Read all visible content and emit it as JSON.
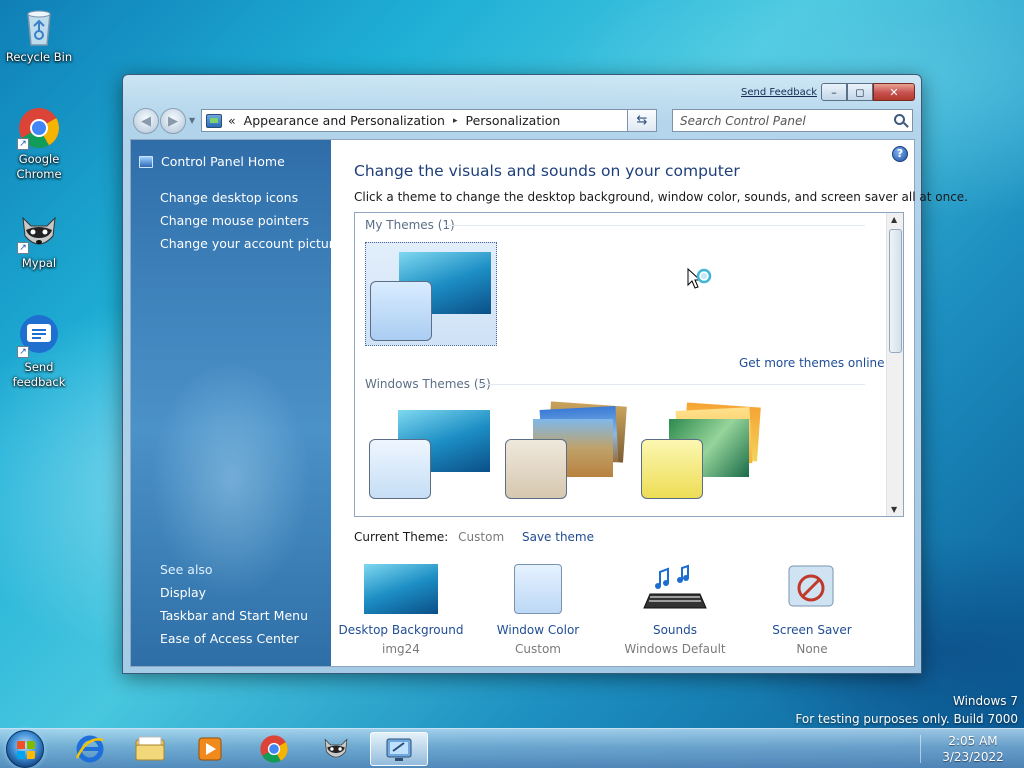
{
  "desktop": {
    "icons": [
      {
        "label": "Recycle Bin",
        "icon": "recycle-bin-icon"
      },
      {
        "label": "Google Chrome",
        "icon": "chrome-icon"
      },
      {
        "label": "Mypal",
        "icon": "mypal-icon"
      },
      {
        "label": "Send feedback",
        "icon": "feedback-icon"
      }
    ],
    "watermark": {
      "line1": "Windows  7",
      "line2": "For testing purposes only. Build 7000"
    }
  },
  "window": {
    "send_feedback": "Send Feedback",
    "title_buttons": {
      "minimize": "–",
      "maximize": "◻",
      "close": "✕"
    },
    "address": {
      "prefix": "«",
      "segments": [
        "Appearance and Personalization",
        "Personalization"
      ],
      "separator": "▸"
    },
    "search_placeholder": "Search Control Panel",
    "sidebar": {
      "home": "Control Panel Home",
      "links": [
        "Change desktop icons",
        "Change mouse pointers",
        "Change your account picture"
      ],
      "see_also_label": "See also",
      "see_also": [
        "Display",
        "Taskbar and Start Menu",
        "Ease of Access Center"
      ]
    },
    "main": {
      "title": "Change the visuals and sounds on your computer",
      "description": "Click a theme to change the desktop background, window color, sounds, and screen saver all at once.",
      "my_themes_label": "My Themes (1)",
      "windows_themes_label": "Windows Themes (5)",
      "get_more": "Get more themes online",
      "current_theme_label": "Current Theme:",
      "current_theme_value": "Custom",
      "save_theme": "Save theme",
      "bottom_items": [
        {
          "label": "Desktop Background",
          "sub": "img24"
        },
        {
          "label": "Window Color",
          "sub": "Custom"
        },
        {
          "label": "Sounds",
          "sub": "Windows Default"
        },
        {
          "label": "Screen Saver",
          "sub": "None"
        }
      ]
    }
  },
  "taskbar": {
    "apps": [
      "start-button",
      "internet-explorer",
      "windows-explorer",
      "media-player",
      "google-chrome",
      "mypal",
      "personalization"
    ],
    "time": "2:05 AM",
    "date": "3/23/2022"
  }
}
